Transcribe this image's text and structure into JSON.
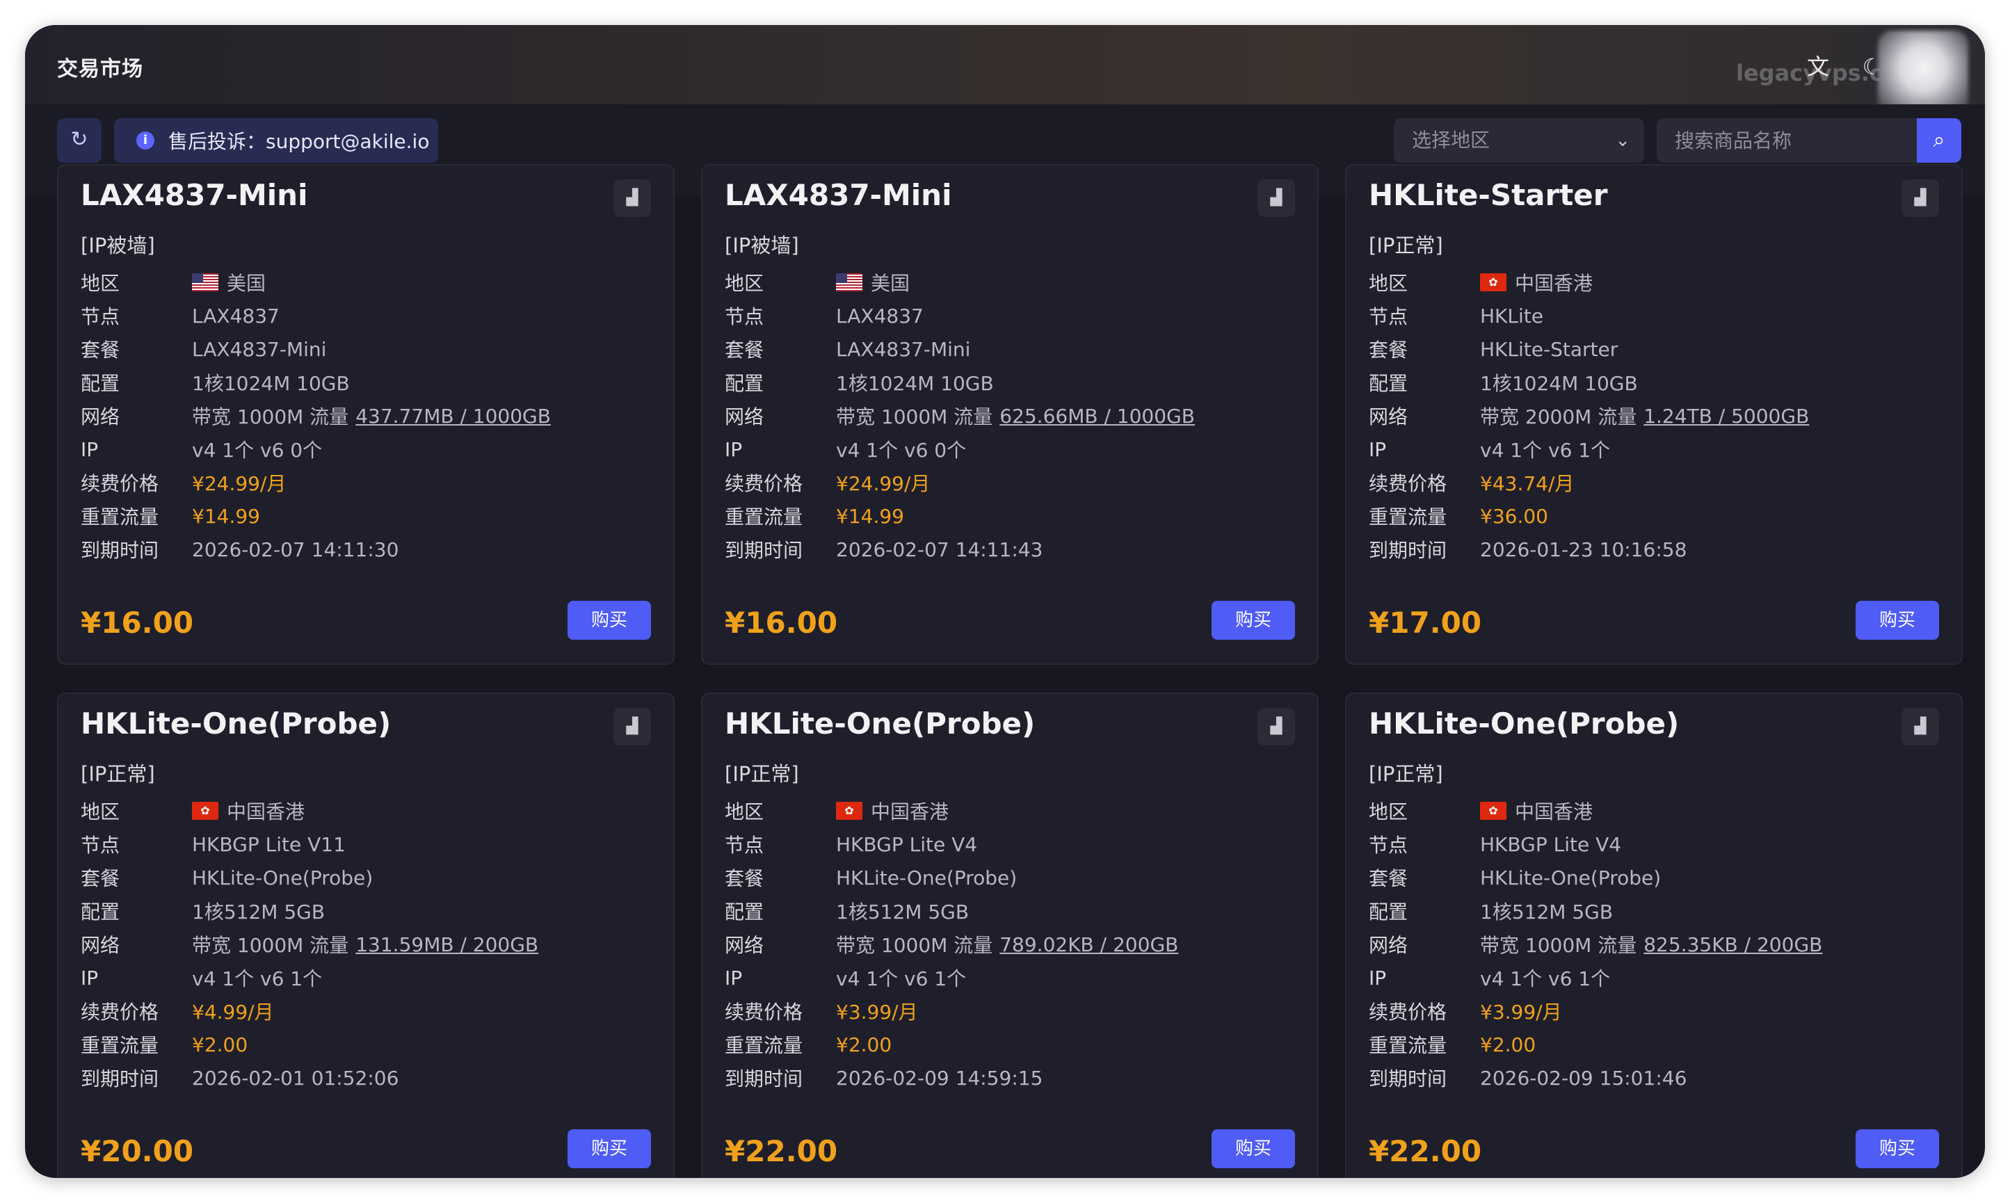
{
  "app": {
    "title": "交易市场",
    "watermark": "legacyvps.com"
  },
  "header": {
    "translate_icon": "translate-icon",
    "theme_icon": "moon-icon"
  },
  "toolbar": {
    "refresh_icon": "refresh-icon",
    "notice_text": "售后投诉：support@akile.io",
    "region_placeholder": "选择地区",
    "search_placeholder": "搜索商品名称",
    "search_icon": "search-icon"
  },
  "labels": {
    "region": "地区",
    "node": "节点",
    "plan": "套餐",
    "config": "配置",
    "network": "网络",
    "ip": "IP",
    "renew": "续费价格",
    "reset": "重置流量",
    "expire": "到期时间",
    "buy": "购买"
  },
  "colors": {
    "accent": "#4f5cf5",
    "price": "#f0a11c",
    "background": "#171721",
    "card": "#1f1f2b"
  },
  "cards": [
    {
      "name": "LAX4837-Mini",
      "ip_status": "[IP被墙]",
      "flag": "us-flag",
      "region": "美国",
      "node": "LAX4837",
      "plan": "LAX4837-Mini",
      "config": "1核1024M 10GB",
      "bandwidth": "带宽 1000M 流量",
      "traffic": "437.77MB / 1000GB",
      "ip": "v4 1个 v6 0个",
      "renew_price": "¥24.99/月",
      "reset_price": "¥14.99",
      "expire": "2026-02-07 14:11:30",
      "price": "¥16.00"
    },
    {
      "name": "LAX4837-Mini",
      "ip_status": "[IP被墙]",
      "flag": "us-flag",
      "region": "美国",
      "node": "LAX4837",
      "plan": "LAX4837-Mini",
      "config": "1核1024M 10GB",
      "bandwidth": "带宽 1000M 流量",
      "traffic": "625.66MB / 1000GB",
      "ip": "v4 1个 v6 0个",
      "renew_price": "¥24.99/月",
      "reset_price": "¥14.99",
      "expire": "2026-02-07 14:11:43",
      "price": "¥16.00"
    },
    {
      "name": "HKLite-Starter",
      "ip_status": "[IP正常]",
      "flag": "hk-flag",
      "region": "中国香港",
      "node": "HKLite",
      "plan": "HKLite-Starter",
      "config": "1核1024M 10GB",
      "bandwidth": "带宽 2000M 流量",
      "traffic": "1.24TB / 5000GB",
      "ip": "v4 1个 v6 1个",
      "renew_price": "¥43.74/月",
      "reset_price": "¥36.00",
      "expire": "2026-01-23 10:16:58",
      "price": "¥17.00"
    },
    {
      "name": "HKLite-One(Probe)",
      "ip_status": "[IP正常]",
      "flag": "hk-flag",
      "region": "中国香港",
      "node": "HKBGP Lite V11",
      "plan": "HKLite-One(Probe)",
      "config": "1核512M 5GB",
      "bandwidth": "带宽 1000M 流量",
      "traffic": "131.59MB / 200GB",
      "ip": "v4 1个 v6 1个",
      "renew_price": "¥4.99/月",
      "reset_price": "¥2.00",
      "expire": "2026-02-01 01:52:06",
      "price": "¥20.00"
    },
    {
      "name": "HKLite-One(Probe)",
      "ip_status": "[IP正常]",
      "flag": "hk-flag",
      "region": "中国香港",
      "node": "HKBGP Lite V4",
      "plan": "HKLite-One(Probe)",
      "config": "1核512M 5GB",
      "bandwidth": "带宽 1000M 流量",
      "traffic": "789.02KB / 200GB",
      "ip": "v4 1个 v6 1个",
      "renew_price": "¥3.99/月",
      "reset_price": "¥2.00",
      "expire": "2026-02-09 14:59:15",
      "price": "¥22.00"
    },
    {
      "name": "HKLite-One(Probe)",
      "ip_status": "[IP正常]",
      "flag": "hk-flag",
      "region": "中国香港",
      "node": "HKBGP Lite V4",
      "plan": "HKLite-One(Probe)",
      "config": "1核512M 5GB",
      "bandwidth": "带宽 1000M 流量",
      "traffic": "825.35KB / 200GB",
      "ip": "v4 1个 v6 1个",
      "renew_price": "¥3.99/月",
      "reset_price": "¥2.00",
      "expire": "2026-02-09 15:01:46",
      "price": "¥22.00"
    }
  ]
}
